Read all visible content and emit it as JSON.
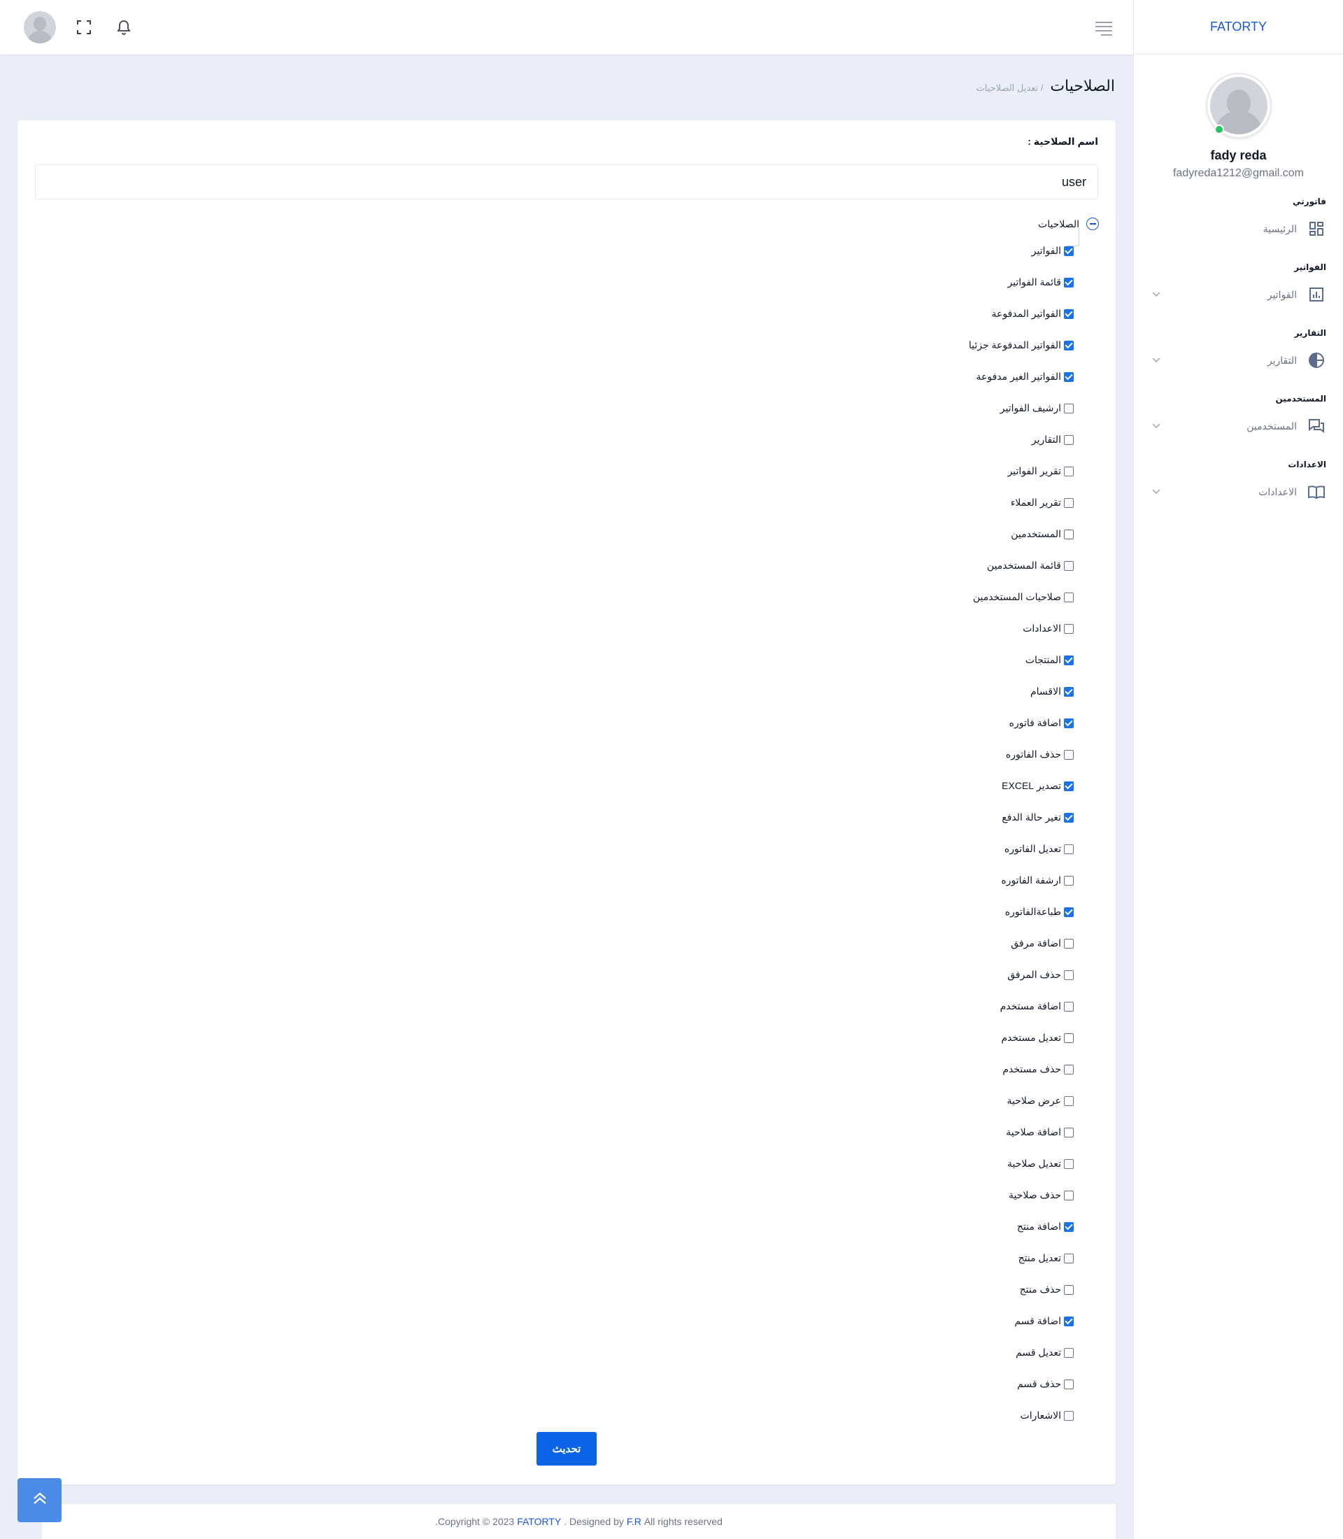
{
  "brand": "FATORTY",
  "profile": {
    "name": "fady reda",
    "email": "fadyreda1212@gmail.com"
  },
  "sidebar": {
    "sections": [
      {
        "title": "فاتورتي",
        "item": "الرئيسية",
        "icon": "dashboard-icon",
        "has_submenu": false
      },
      {
        "title": "الفواتير",
        "item": "الفواتير",
        "icon": "bar-chart-icon",
        "has_submenu": true
      },
      {
        "title": "التقارير",
        "item": "التقارير",
        "icon": "pie-chart-icon",
        "has_submenu": true
      },
      {
        "title": "المستخدمين",
        "item": "المستخدمين",
        "icon": "chat-icon",
        "has_submenu": true
      },
      {
        "title": "الاعدادات",
        "item": "الاعدادات",
        "icon": "book-icon",
        "has_submenu": true
      }
    ]
  },
  "header": {
    "title": "الصلاحيات",
    "breadcrumb": "/ تعديل الصلاحيات"
  },
  "form": {
    "name_label": "اسم الصلاحية :",
    "name_value": "user",
    "tree_root": "الصلاحيات",
    "submit_label": "تحديث",
    "permissions": [
      {
        "label": "الفواتير",
        "checked": true
      },
      {
        "label": "قائمة الفواتير",
        "checked": true
      },
      {
        "label": "الفواتير المدفوعة",
        "checked": true
      },
      {
        "label": "الفواتير المدفوعة جزئيا",
        "checked": true
      },
      {
        "label": "الفواتير الغير مدفوعة",
        "checked": true
      },
      {
        "label": "ارشيف الفواتير",
        "checked": false
      },
      {
        "label": "التقارير",
        "checked": false
      },
      {
        "label": "تقرير الفواتير",
        "checked": false
      },
      {
        "label": "تقرير العملاء",
        "checked": false
      },
      {
        "label": "المستخدمين",
        "checked": false
      },
      {
        "label": "قائمة المستخدمين",
        "checked": false
      },
      {
        "label": "صلاحيات المستخدمين",
        "checked": false
      },
      {
        "label": "الاعدادات",
        "checked": false
      },
      {
        "label": "المنتجات",
        "checked": true
      },
      {
        "label": "الاقسام",
        "checked": true
      },
      {
        "label": "اضافة فاتوره",
        "checked": true
      },
      {
        "label": "حذف الفاتوره",
        "checked": false
      },
      {
        "label": "تصدير EXCEL",
        "checked": true
      },
      {
        "label": "تغير حالة الدفع",
        "checked": true
      },
      {
        "label": "تعديل الفاتوره",
        "checked": false
      },
      {
        "label": "ارشفة الفاتوره",
        "checked": false
      },
      {
        "label": "طباعةالفاتوره",
        "checked": true
      },
      {
        "label": "اضافة مرفق",
        "checked": false
      },
      {
        "label": "حذف المرفق",
        "checked": false
      },
      {
        "label": "اضافة مستخدم",
        "checked": false
      },
      {
        "label": "تعديل مستخدم",
        "checked": false
      },
      {
        "label": "حذف مستخدم",
        "checked": false
      },
      {
        "label": "عرض صلاحية",
        "checked": false
      },
      {
        "label": "اضافة صلاحية",
        "checked": false
      },
      {
        "label": "تعديل صلاحية",
        "checked": false
      },
      {
        "label": "حذف صلاحية",
        "checked": false
      },
      {
        "label": "اضافة منتج",
        "checked": true
      },
      {
        "label": "تعديل منتج",
        "checked": false
      },
      {
        "label": "حذف منتج",
        "checked": false
      },
      {
        "label": "اضافة قسم",
        "checked": true
      },
      {
        "label": "تعديل قسم",
        "checked": false
      },
      {
        "label": "حذف قسم",
        "checked": false
      },
      {
        "label": "الاشعارات",
        "checked": false
      }
    ]
  },
  "footer": {
    "prefix": ".Copyright © 2023",
    "brand": "FATORTY",
    "middle": ". Designed by",
    "author": "F.R",
    "suffix": "All rights reserved"
  },
  "colors": {
    "accent": "#1a56db",
    "button": "#0b63e5",
    "checkbox": "#1a73e8",
    "background": "#eaeef8"
  }
}
